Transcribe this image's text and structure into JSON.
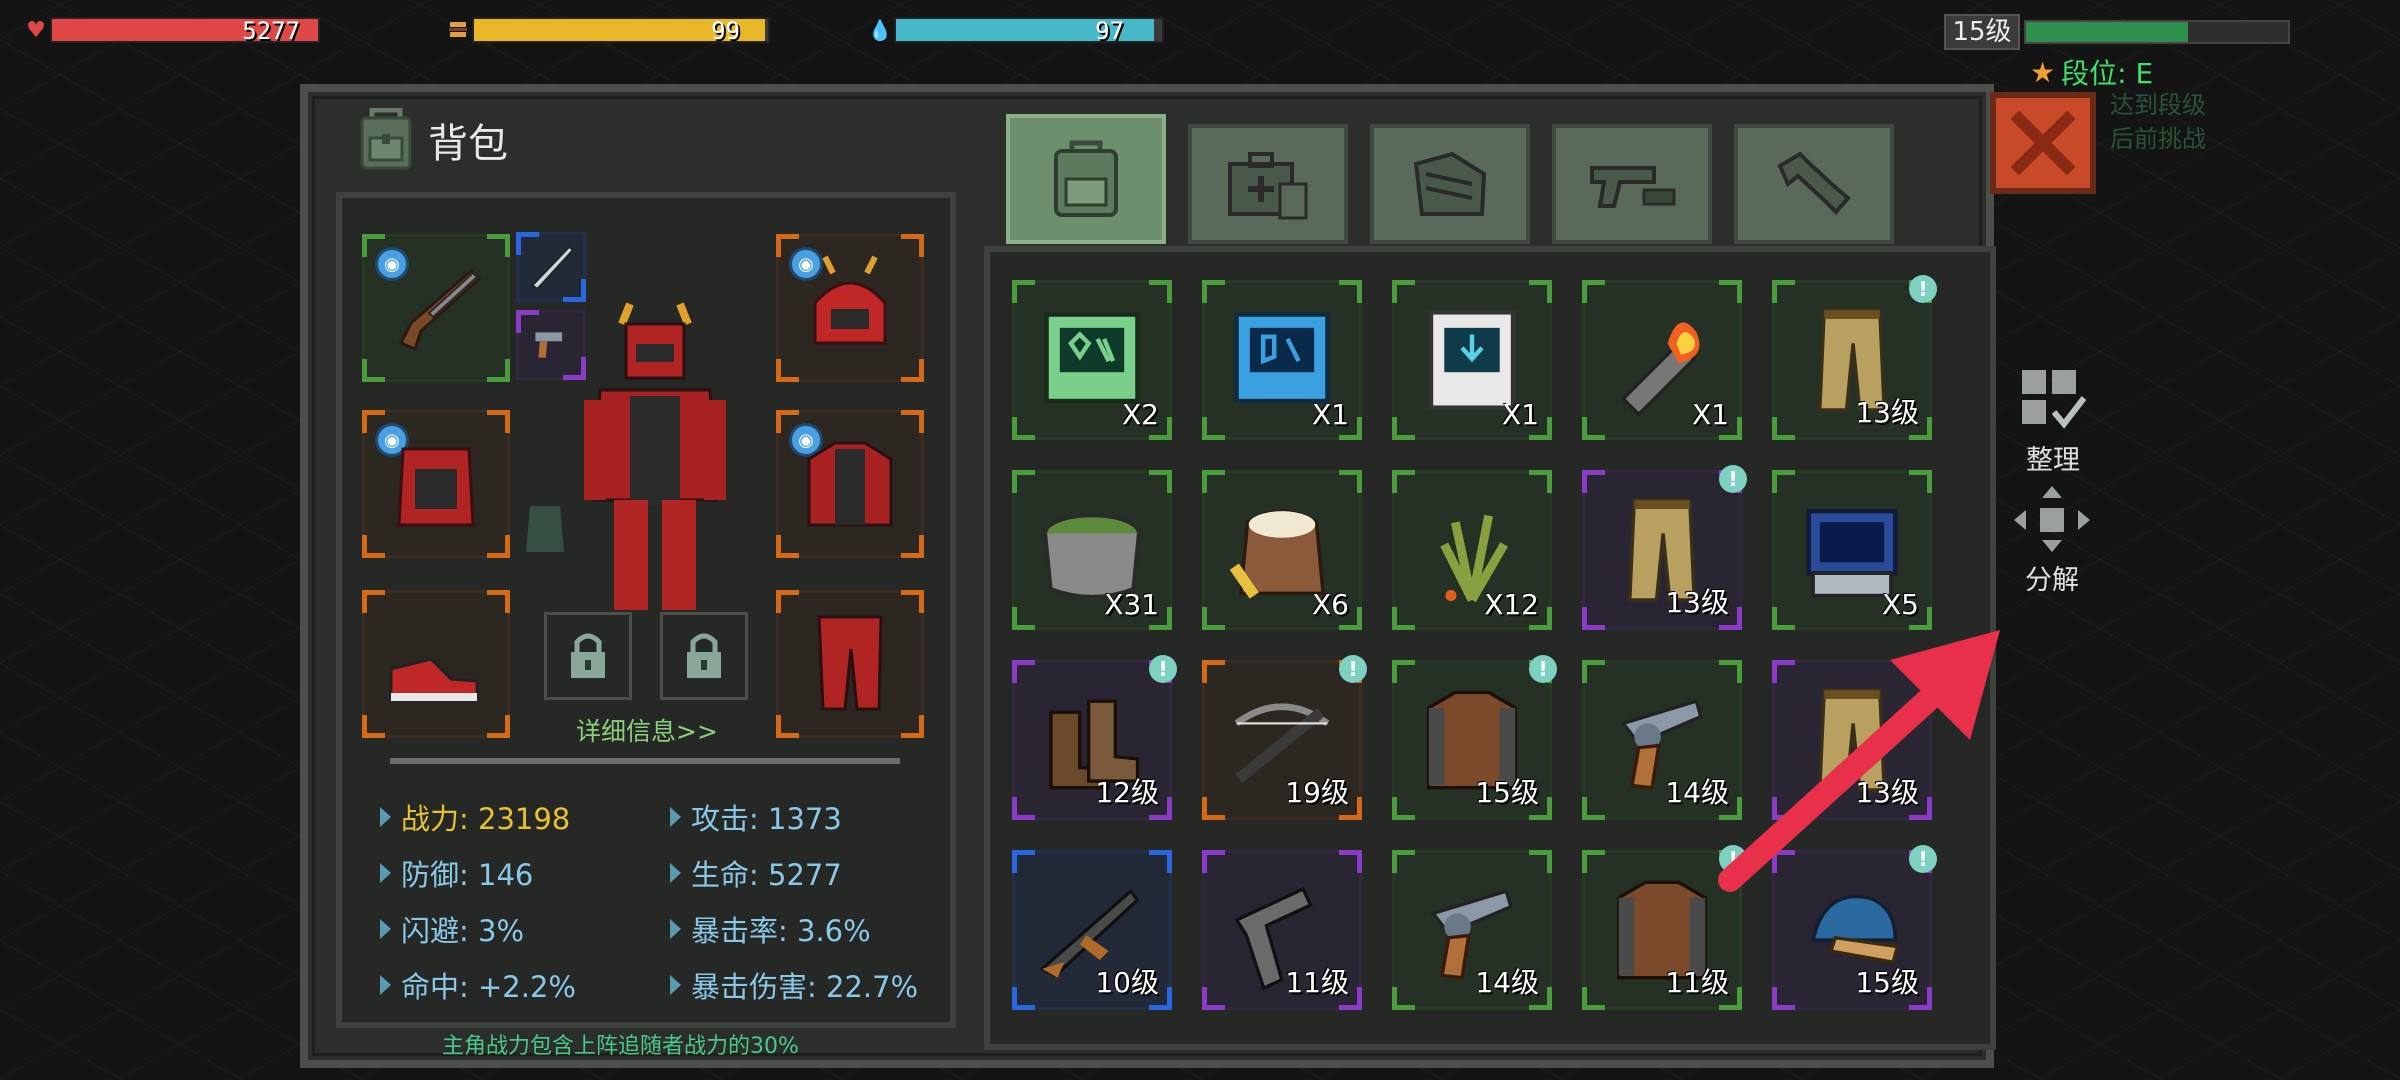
{
  "hud": {
    "health": {
      "value": "5277",
      "fill_fraction": 1.0,
      "color": "#e04848",
      "icon": "heart-icon"
    },
    "food": {
      "value": "99",
      "fill_fraction": 0.99,
      "color": "#e8b828",
      "icon": "burger-icon"
    },
    "water": {
      "value": "97",
      "fill_fraction": 0.97,
      "color": "#46b8c8",
      "icon": "water-drop-icon"
    },
    "level": "15级",
    "xp_fill_fraction": 0.62,
    "rank": "段位: E"
  },
  "panel": {
    "title": "背包",
    "detail_link": "详细信息>>",
    "note": "主角战力包含上阵追随者战力的30%",
    "tabs": [
      "backpack",
      "medical-kit",
      "materials",
      "weapons",
      "tools"
    ],
    "active_tab": "backpack"
  },
  "stats": [
    {
      "label": "战力: 23198",
      "kind": "power"
    },
    {
      "label": "攻击: 1373",
      "kind": "normal"
    },
    {
      "label": "防御: 146",
      "kind": "normal"
    },
    {
      "label": "生命: 5277",
      "kind": "normal"
    },
    {
      "label": "闪避: 3%",
      "kind": "normal"
    },
    {
      "label": "暴击率: 3.6%",
      "kind": "normal"
    },
    {
      "label": "命中: +2.2%",
      "kind": "normal"
    },
    {
      "label": "暴击伤害: 22.7%",
      "kind": "normal"
    }
  ],
  "items": [
    {
      "name": "green-monitor",
      "label": "X2",
      "quality": "green",
      "alert": false
    },
    {
      "name": "blue-monitor",
      "label": "X1",
      "quality": "green",
      "alert": false
    },
    {
      "name": "white-device",
      "label": "X1",
      "quality": "green",
      "alert": false
    },
    {
      "name": "fire-capsule",
      "label": "X1",
      "quality": "green",
      "alert": false
    },
    {
      "name": "khaki-pants",
      "label": "13级",
      "quality": "green",
      "alert": true
    },
    {
      "name": "green-soup",
      "label": "X31",
      "quality": "green",
      "alert": false
    },
    {
      "name": "rice-sack",
      "label": "X6",
      "quality": "green",
      "alert": false
    },
    {
      "name": "herbs",
      "label": "X12",
      "quality": "green",
      "alert": false
    },
    {
      "name": "khaki-pants",
      "label": "13级",
      "quality": "purple",
      "alert": true
    },
    {
      "name": "tech-console",
      "label": "X5",
      "quality": "green",
      "alert": false
    },
    {
      "name": "boots",
      "label": "12级",
      "quality": "purple",
      "alert": true
    },
    {
      "name": "crossbow",
      "label": "19级",
      "quality": "orange",
      "alert": true
    },
    {
      "name": "leather-jacket",
      "label": "15级",
      "quality": "green",
      "alert": true
    },
    {
      "name": "revolver",
      "label": "14级",
      "quality": "green",
      "alert": false
    },
    {
      "name": "khaki-pants",
      "label": "13级",
      "quality": "purple",
      "alert": true
    },
    {
      "name": "assault-rifle",
      "label": "10级",
      "quality": "blue",
      "alert": false
    },
    {
      "name": "pistol",
      "label": "11级",
      "quality": "purple",
      "alert": false
    },
    {
      "name": "revolver",
      "label": "14级",
      "quality": "green",
      "alert": false
    },
    {
      "name": "leather-jacket",
      "label": "11级",
      "quality": "green",
      "alert": true
    },
    {
      "name": "blue-cap",
      "label": "15级",
      "quality": "purple",
      "alert": true
    }
  ],
  "side": {
    "sort_label": "整理",
    "decompose_label": "分解"
  },
  "rank_ghost": [
    "达到段级",
    "后前挑战"
  ]
}
